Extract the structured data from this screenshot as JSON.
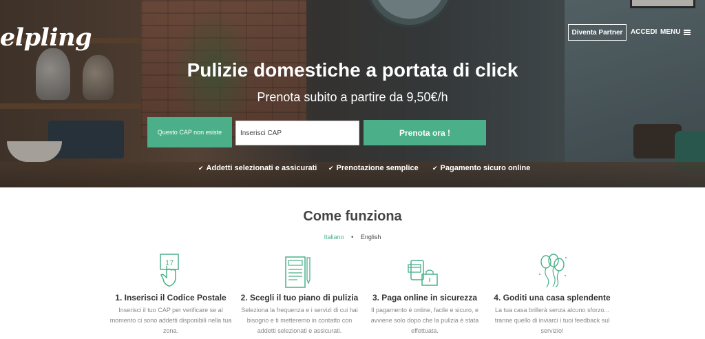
{
  "brand": {
    "logo_text": "elpling",
    "accent_color": "#4bb08a"
  },
  "nav": {
    "partner_label": "Diventa Partner",
    "login_label": "ACCEDI",
    "menu_label": "MENU",
    "menu_icon": "hamburger-icon"
  },
  "hero": {
    "title": "Pulizie domestiche a portata di click",
    "subtitle": "Prenota subito a partire da 9,50€/h",
    "cap_error": "Questo CAP non esiste",
    "cap_placeholder": "Inserisci CAP",
    "book_button": "Prenota ora !",
    "features": [
      {
        "icon": "checkmark-icon",
        "label": "Addetti selezionati e assicurati"
      },
      {
        "icon": "checkmark-icon",
        "label": "Prenotazione semplice"
      },
      {
        "icon": "checkmark-icon",
        "label": "Pagamento sicuro online"
      }
    ]
  },
  "how_it_works": {
    "title": "Come funziona",
    "languages": [
      {
        "label": "Italiano",
        "active": true
      },
      {
        "label": "English",
        "active": false
      }
    ],
    "steps": [
      {
        "icon": "postal-code-hand-icon",
        "title": "1. Inserisci il Codice Postale",
        "description": "Inserisci il tuo CAP per verificare se al momento ci sono addetti disponibili nella tua zona."
      },
      {
        "icon": "cleaning-plan-icon",
        "title": "2. Scegli il tuo piano di pulizia",
        "description": "Seleziona la frequenza e i servizi di cui hai bisogno e ti metteremo in contatto con addetti selezionati e assicurati."
      },
      {
        "icon": "secure-payment-icon",
        "title": "3. Paga online in sicurezza",
        "description": "Il pagamento è online, facile e sicuro, e avviene solo dopo che la pulizia è stata effettuata."
      },
      {
        "icon": "balloons-icon",
        "title": "4. Goditi una casa splendente",
        "description": "La tua casa brillerà senza alcuno sforzo... tranne quello di inviarci i tuoi feedback sul servizio!"
      }
    ]
  }
}
